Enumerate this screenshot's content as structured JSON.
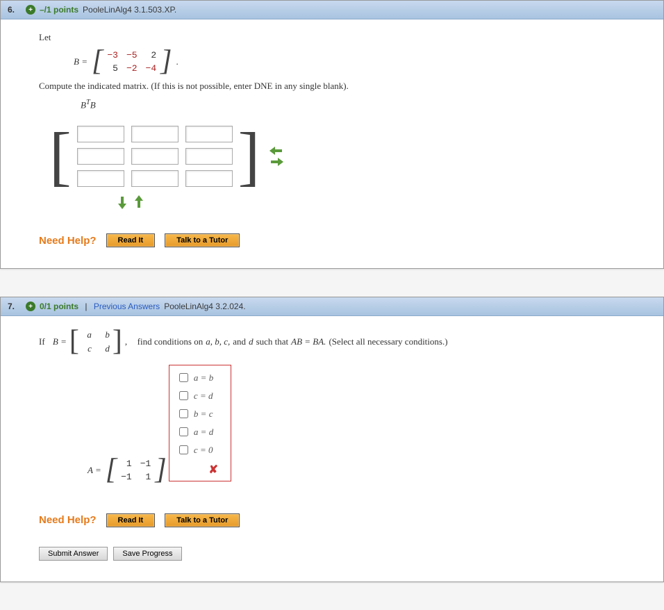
{
  "q6": {
    "number": "6.",
    "points": "–/1 points",
    "ref": "PooleLinAlg4 3.1.503.XP.",
    "let": "Let",
    "eqlabel": "B =",
    "matB": [
      "−3",
      "−5",
      "2",
      "5",
      "−2",
      "−4"
    ],
    "period": ".",
    "instruction": "Compute the indicated matrix. (If this is not possible, enter DNE in any single blank).",
    "expr_html": "B<sup>T</sup>B",
    "help_label": "Need Help?",
    "read_it": "Read It",
    "talk_tutor": "Talk to a Tutor"
  },
  "q7": {
    "number": "7.",
    "points": "0/1 points",
    "prev": "Previous Answers",
    "ref": "PooleLinAlg4 3.2.024.",
    "if": "If",
    "eqlabel": "B =",
    "matB": [
      "a",
      "b",
      "c",
      "d"
    ],
    "comma": ",",
    "instruction_pre": "find conditions on ",
    "instruction_vars": "a, b, c,",
    "instruction_and": " and ",
    "instruction_d": "d",
    "instruction_mid": " such that ",
    "instruction_eq": "AB = BA.",
    "instruction_post": "  (Select all necessary conditions.)",
    "eqlabelA": "A =",
    "matA": [
      "1",
      "−1",
      "−1",
      "1"
    ],
    "choices": [
      "a = b",
      "c = d",
      "b = c",
      "a = d",
      "c = 0"
    ],
    "wrong_mark": "✘",
    "help_label": "Need Help?",
    "read_it": "Read It",
    "talk_tutor": "Talk to a Tutor",
    "submit": "Submit Answer",
    "save": "Save Progress"
  }
}
